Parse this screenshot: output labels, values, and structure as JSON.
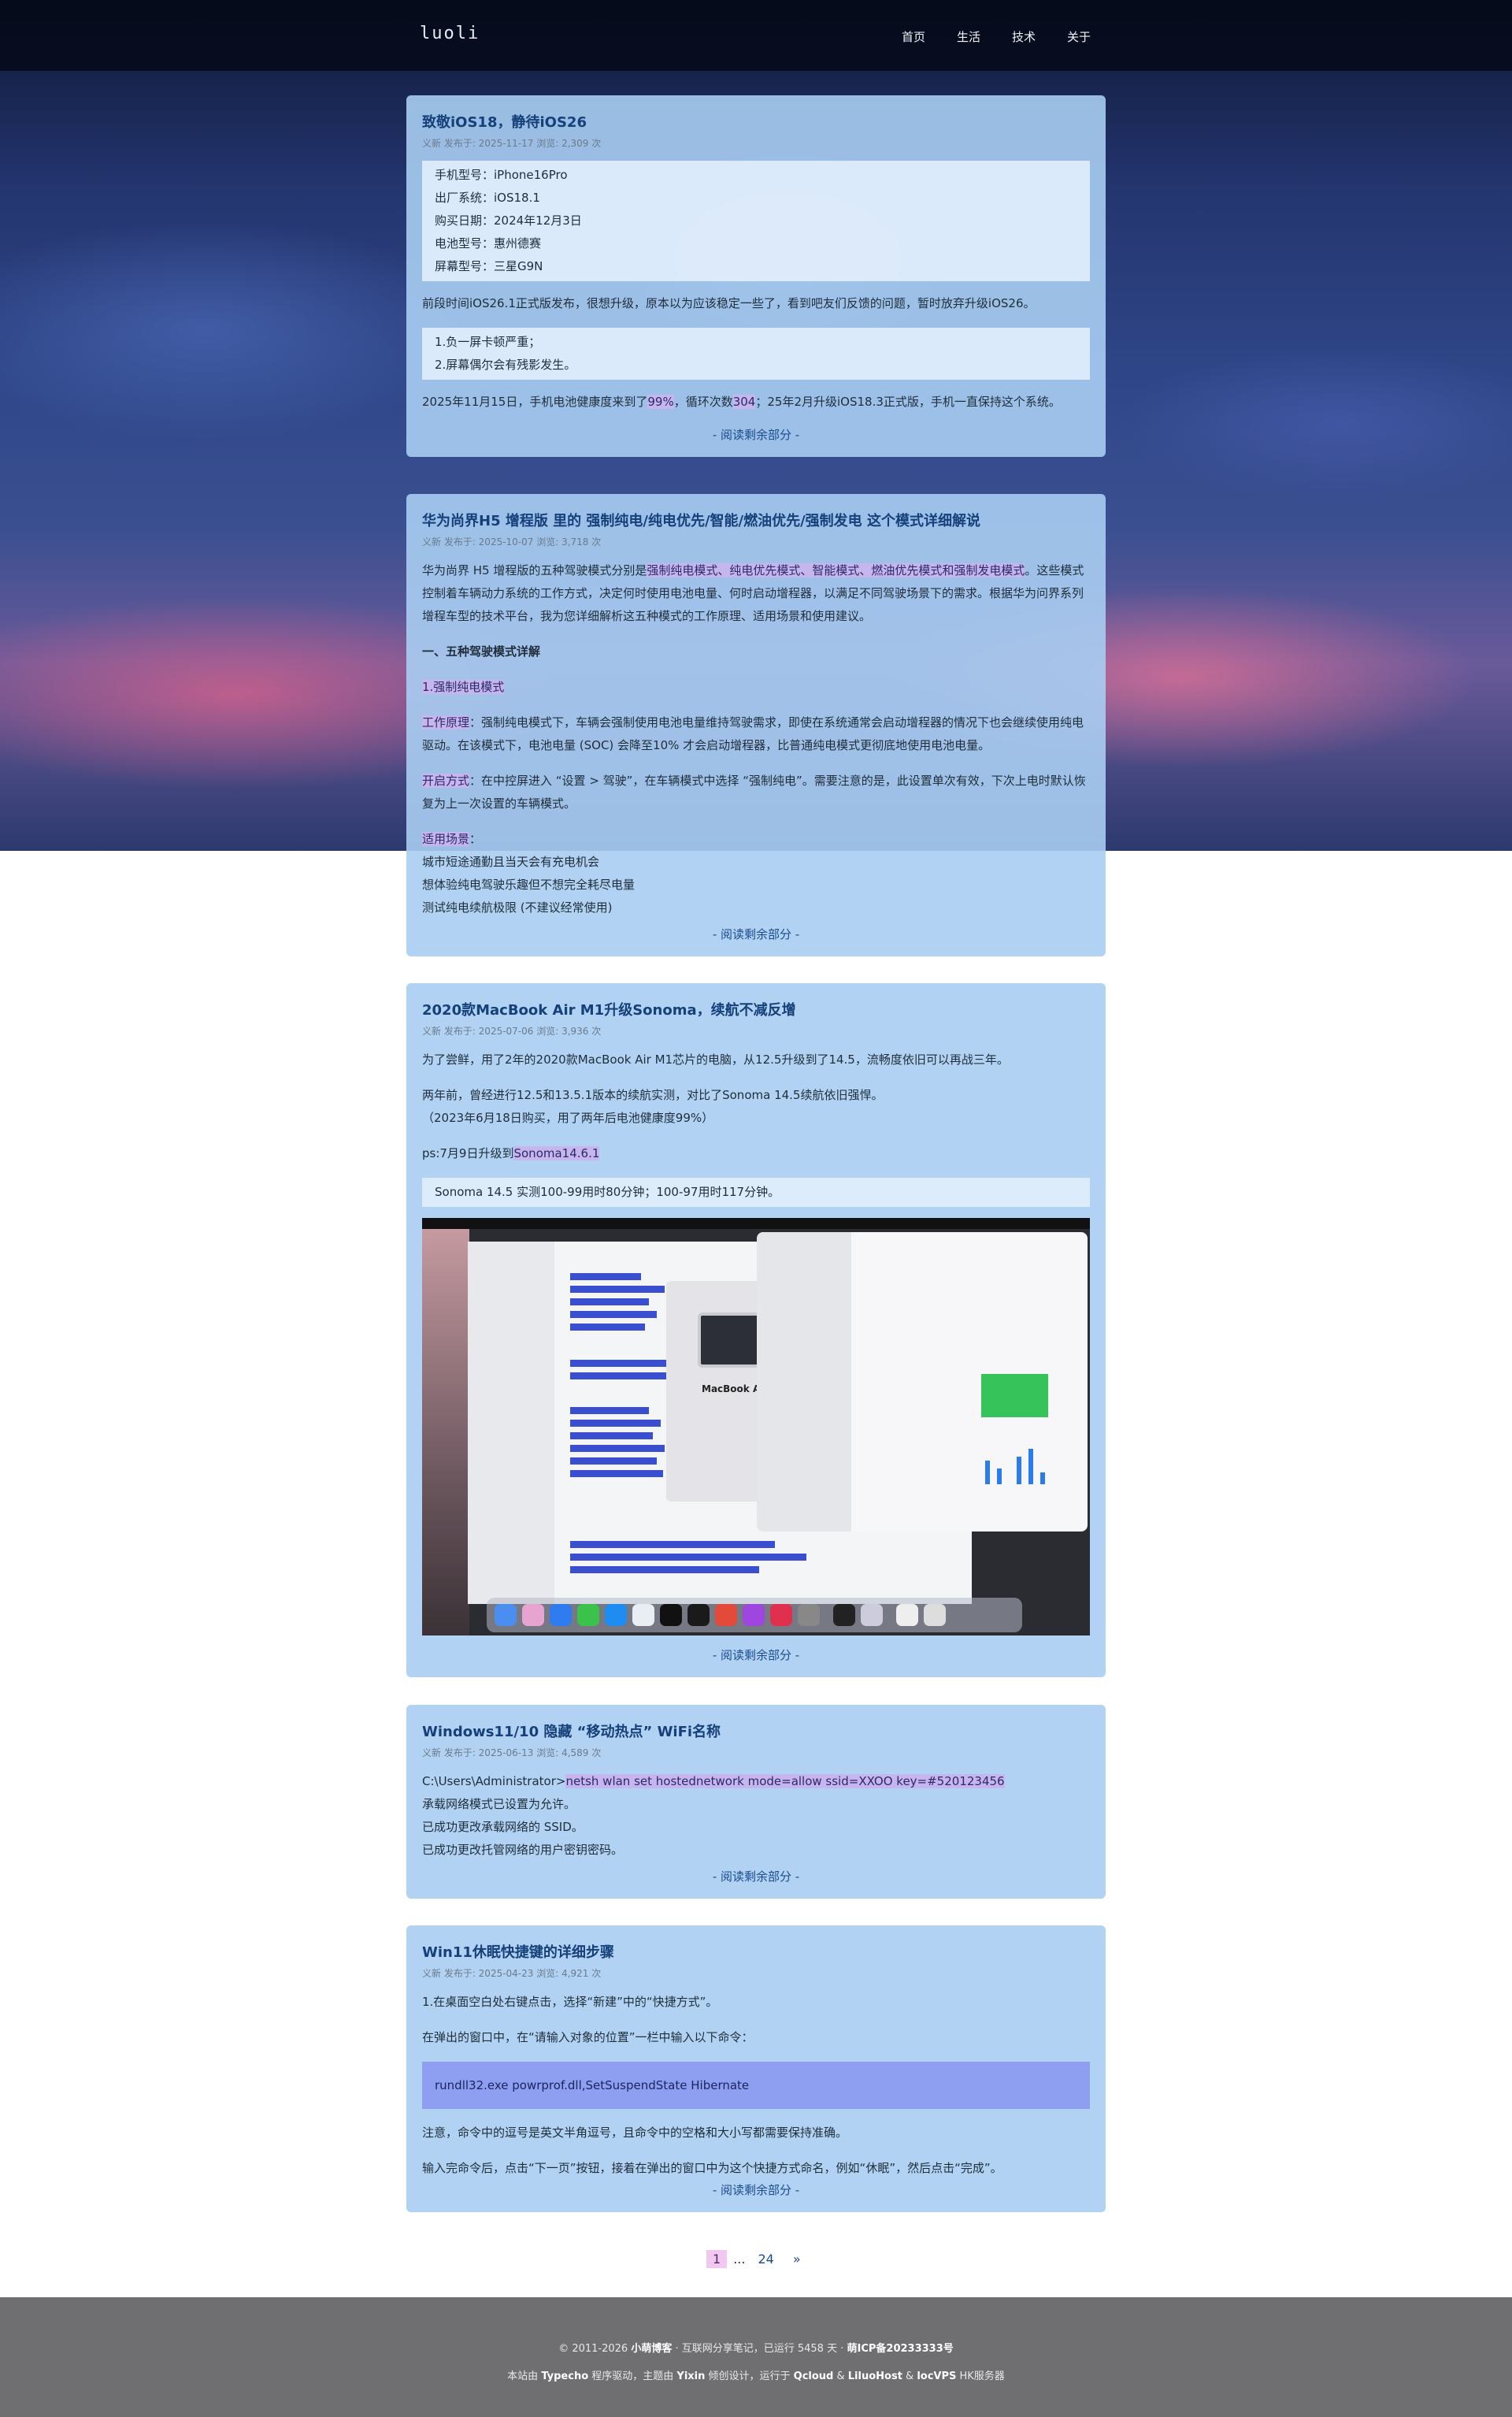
{
  "site": {
    "logo": "luoli"
  },
  "nav": [
    {
      "label": "首页"
    },
    {
      "label": "生活"
    },
    {
      "label": "技术"
    },
    {
      "label": "关于"
    }
  ],
  "posts": [
    {
      "title": "致敬iOS18，静待iOS26",
      "meta": "义新 发布于: 2025-11-17 浏览: 2,309 次",
      "specs": [
        "手机型号：iPhone16Pro",
        "出厂系统：iOS18.1",
        "购买日期：2024年12月3日",
        "电池型号：惠州德赛",
        "屏幕型号：三星G9N"
      ],
      "p1": "前段时间iOS26.1正式版发布，很想升级，原本以为应该稳定一些了，看到吧友们反馈的问题，暂时放弃升级iOS26。",
      "issues": [
        "1.负一屏卡顿严重；",
        "2.屏幕偶尔会有残影发生。"
      ],
      "p2_a": "2025年11月15日，手机电池健康度来到了",
      "p2_h1": "99%",
      "p2_b": "，循环次数",
      "p2_h2": "304",
      "p2_c": "；25年2月升级iOS18.3正式版，手机一直保持这个系统。",
      "more": "- 阅读剩余部分 -"
    },
    {
      "title": "华为尚界H5 增程版 里的 强制纯电/纯电优先/智能/燃油优先/强制发电 这个模式详细解说",
      "meta": "义新 发布于: 2025-10-07 浏览: 3,718 次",
      "intro_a": "华为尚界 H5 增程版的五种驾驶模式分别是",
      "modes": "强制纯电模式、纯电优先模式、智能模式、燃油优先模式和强制发电模式",
      "intro_b": "。这些模式控制着车辆动力系统的工作方式，决定何时使用电池电量、何时启动增程器，以满足不同驾驶场景下的需求。根据华为问界系列增程车型的技术平台，我为您详细解析这五种模式的工作原理、适用场景和使用建议。",
      "section": "一、五种驾驶模式详解",
      "sub": "1.强制纯电模式",
      "work_label": "工作原理",
      "work": "：强制纯电模式下，车辆会强制使用电池电量维持驾驶需求，即使在系统通常会启动增程器的情况下也会继续使用纯电驱动。在该模式下，电池电量 (SOC) 会降至10% 才会启动增程器，比普通纯电模式更彻底地使用电池电量。",
      "on_label": "开启方式",
      "on": "：在中控屏进入 “设置 > 驾驶”，在车辆模式中选择 “强制纯电”。需要注意的是，此设置单次有效，下次上电时默认恢复为上一次设置的车辆模式。",
      "scene_label": "适用场景",
      "scene_colon": "：",
      "scenes": [
        "城市短途通勤且当天会有充电机会",
        "想体验纯电驾驶乐趣但不想完全耗尽电量",
        "测试纯电续航极限 (不建议经常使用)"
      ],
      "more": "- 阅读剩余部分 -"
    },
    {
      "title": "2020款MacBook Air M1升级Sonoma，续航不减反增",
      "meta": "义新 发布于: 2025-07-06 浏览: 3,936 次",
      "p1": "为了尝鲜，用了2年的2020款MacBook Air M1芯片的电脑，从12.5升级到了14.5，流畅度依旧可以再战三年。",
      "p2": "两年前，曾经进行12.5和13.5.1版本的续航实测，对比了Sonoma 14.5续航依旧强悍。",
      "p3": "（2023年6月18日购买，用了两年后电池健康度99%）",
      "ps_a": "ps:7月9日升级到",
      "ps_h": "Sonoma14.6.1",
      "quote": "Sonoma 14.5 实测100-99用时80分钟；100-97用时117分钟。",
      "shot_title": "MacBook Ai",
      "more": "- 阅读剩余部分 -"
    },
    {
      "title": "Windows11/10 隐藏 “移动热点” WiFi名称",
      "meta": "义新 发布于: 2025-06-13 浏览: 4,589 次",
      "cmd_prefix": "C:\\Users\\Administrator>",
      "cmd": "netsh wlan set hostednetwork mode=allow ssid=XXOO key=#520123456",
      "lines": [
        "承载网络模式已设置为允许。",
        "已成功更改承载网络的 SSID。",
        "已成功更改托管网络的用户密钥密码。"
      ],
      "more": "- 阅读剩余部分 -"
    },
    {
      "title": "Win11休眠快捷键的详细步骤",
      "meta": "义新 发布于: 2025-04-23 浏览: 4,921 次",
      "p1": "1.在桌面空白处右键点击，选择“新建”中的“快捷方式”。",
      "p2": "在弹出的窗口中，在“请输入对象的位置”一栏中输入以下命令：",
      "code": "rundll32.exe powrprof.dll,SetSuspendState Hibernate",
      "p3": "注意，命令中的逗号是英文半角逗号，且命令中的空格和大小写都需要保持准确。",
      "p4": "输入完命令后，点击“下一页”按钮，接着在弹出的窗口中为这个快捷方式命名，例如“休眠”，然后点击“完成”。",
      "more": "- 阅读剩余部分 -"
    }
  ],
  "pagination": {
    "current": "1",
    "ellipsis": "...",
    "last": "24",
    "next": "»"
  },
  "footer": {
    "l1_a": "© 2011-2026 ",
    "l1_site": "小萌博客",
    "l1_b": " · 互联网分享笔记，已运行 5458 天 · ",
    "l1_icp": "萌ICP备20233333号",
    "l2_a": "本站由 ",
    "l2_typecho": "Typecho",
    "l2_b": " 程序驱动，主题由 ",
    "l2_yixin": "Yixin",
    "l2_c": " 倾创设计，运行于 ",
    "l2_qcloud": "Qcloud",
    "l2_amp1": " & ",
    "l2_liluo": "LiluoHost",
    "l2_amp2": " & ",
    "l2_locvps": "locVPS",
    "l2_hk": " HK服务器"
  },
  "colors": {
    "card": "#a8cdf2",
    "title": "#15407a",
    "highlight": "#c7b6ee",
    "footer": "#6f6f72"
  }
}
